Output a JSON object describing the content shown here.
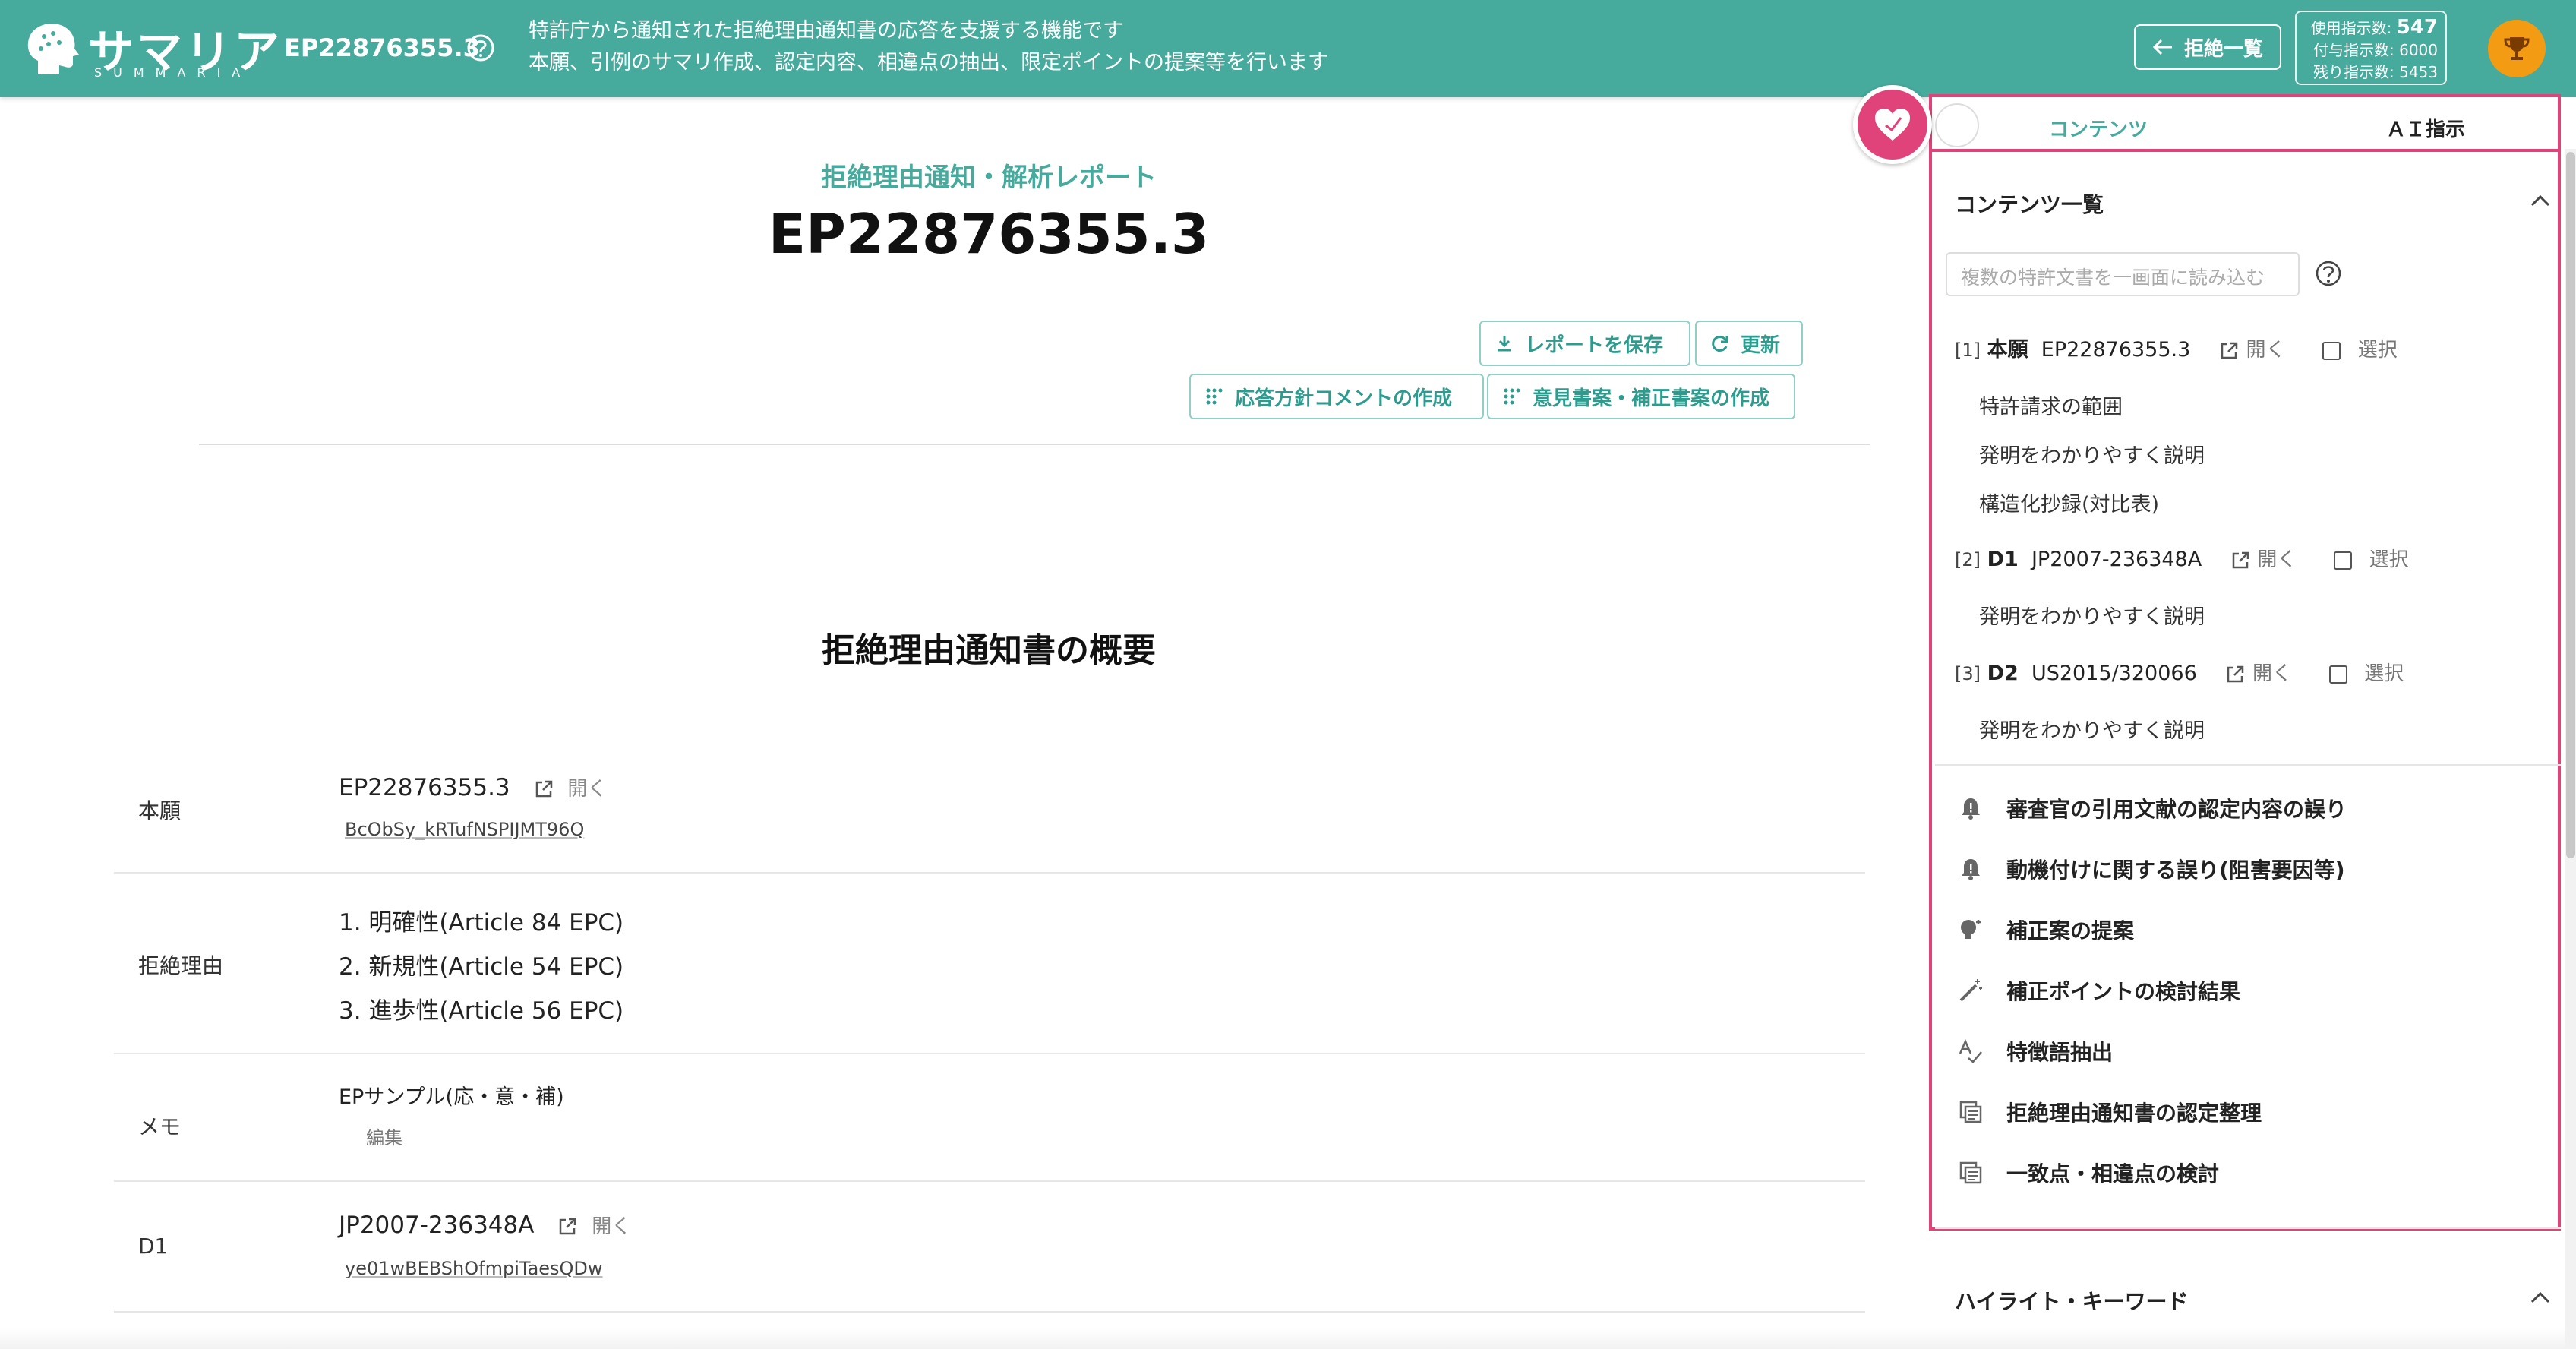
{
  "header": {
    "logo_text": "サマリア",
    "logo_sub": "SUMMARIA",
    "doc_id": "EP22876355.3",
    "description_line1": "特許庁から通知された拒絶理由通知書の応答を支援する機能です",
    "description_line2": "本願、引例のサマリ作成、認定内容、相違点の抽出、限定ポイントの提案等を行います",
    "back_label": "拒絶一覧",
    "counts": {
      "used_label": "使用指示数:",
      "used_value": "547",
      "granted_label": "付与指示数:",
      "granted_value": "6000",
      "remaining_label": "残り指示数:",
      "remaining_value": "5453"
    }
  },
  "report": {
    "kicker": "拒絶理由通知・解析レポート",
    "title": "EP22876355.3",
    "save_label": "レポートを保存",
    "refresh_label": "更新",
    "response_comment_label": "応答方針コメントの作成",
    "opinion_label": "意見書案・補正書案の作成",
    "section_title": "拒絶理由通知書の概要"
  },
  "summary_table": {
    "rows": [
      {
        "label": "本願",
        "value": "EP22876355.3",
        "open": "開く",
        "sub": "BcObSy_kRTufNSPIJMT96Q"
      },
      {
        "label": "拒絶理由",
        "reasons": [
          "1. 明確性(Article 84 EPC)",
          "2. 新規性(Article 54 EPC)",
          "3. 進歩性(Article 56 EPC)"
        ]
      },
      {
        "label": "メモ",
        "value": "EPサンプル(応・意・補)",
        "sub": "編集"
      },
      {
        "label": "D1",
        "value": "JP2007-236348A",
        "open": "開く",
        "sub": "ye01wBEBShOfmpiTaesQDw"
      }
    ]
  },
  "panel": {
    "tabs": [
      "コンテンツ",
      "ＡＩ指示"
    ],
    "contents_title": "コンテンツ一覧",
    "load_placeholder": "複数の特許文書を一画面に読み込む",
    "docs": [
      {
        "index": "[1]",
        "kind": "本願",
        "number": "EP22876355.3",
        "open": "開く",
        "select": "選択",
        "items": [
          "特許請求の範囲",
          "発明をわかりやすく説明",
          "構造化抄録(対比表)"
        ]
      },
      {
        "index": "[2]",
        "kind": "D1",
        "number": "JP2007-236348A",
        "open": "開く",
        "select": "選択",
        "items": [
          "発明をわかりやすく説明"
        ]
      },
      {
        "index": "[3]",
        "kind": "D2",
        "number": "US2015/320066",
        "open": "開く",
        "select": "選択",
        "items": [
          "発明をわかりやすく説明"
        ]
      }
    ],
    "menu": [
      {
        "label": "審査官の引用文献の認定内容の誤り",
        "icon": "bell-icon"
      },
      {
        "label": "動機付けに関する誤り(阻害要因等)",
        "icon": "bell-icon"
      },
      {
        "label": "補正案の提案",
        "icon": "lightbulb-icon"
      },
      {
        "label": "補正ポイントの検討結果",
        "icon": "magic-wand-icon"
      },
      {
        "label": "特徴語抽出",
        "icon": "spellcheck-icon"
      },
      {
        "label": "拒絶理由通知書の認定整理",
        "icon": "documents-icon"
      },
      {
        "label": "一致点・相違点の検討",
        "icon": "documents-icon"
      }
    ],
    "highlight_title": "ハイライト・キーワード"
  },
  "colors": {
    "brand": "#46aa9d",
    "accent_pink": "#e0427a",
    "trophy": "#f39b12"
  }
}
